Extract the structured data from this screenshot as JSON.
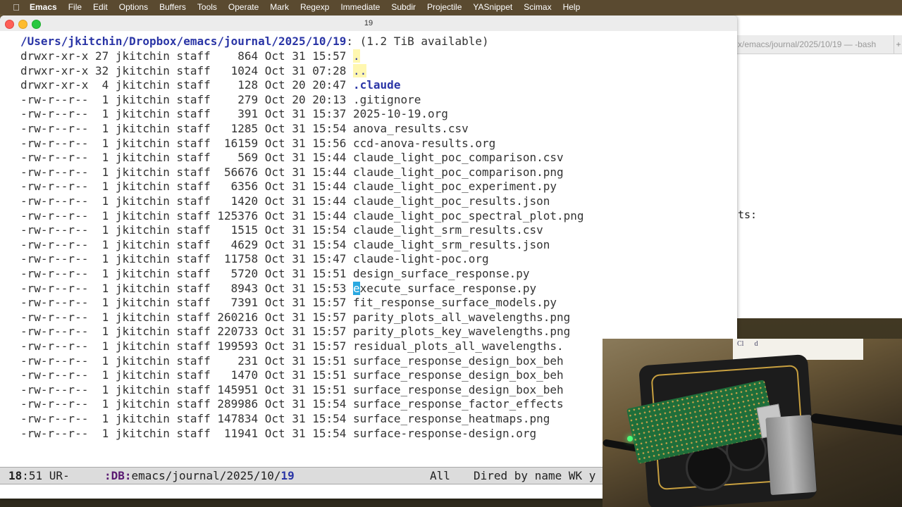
{
  "menubar": {
    "items": [
      "Emacs",
      "File",
      "Edit",
      "Options",
      "Buffers",
      "Tools",
      "Operate",
      "Mark",
      "Regexp",
      "Immediate",
      "Subdir",
      "Projectile",
      "YASnippet",
      "Scimax",
      "Help"
    ]
  },
  "window": {
    "title": "19"
  },
  "terminal": {
    "tab_title": "x/emacs/journal/2025/10/19 — -bash",
    "tab_add": "+",
    "partial_text": "ts:"
  },
  "dired": {
    "header": {
      "path": "/Users/jkitchin/Dropbox/emacs/journal/2025/10/19",
      "rest": ": (1.2 TiB available)"
    },
    "entries": [
      {
        "perm": "drwxr-xr-x",
        "links": "27",
        "owner": "jkitchin",
        "group": "staff",
        "size": "864",
        "date": "Oct 31 15:57",
        "name": ".",
        "kind": "dot"
      },
      {
        "perm": "drwxr-xr-x",
        "links": "32",
        "owner": "jkitchin",
        "group": "staff",
        "size": "1024",
        "date": "Oct 31 07:28",
        "name": "..",
        "kind": "dot"
      },
      {
        "perm": "drwxr-xr-x",
        "links": "4",
        "owner": "jkitchin",
        "group": "staff",
        "size": "128",
        "date": "Oct 20 20:47",
        "name": ".claude",
        "kind": "dir"
      },
      {
        "perm": "-rw-r--r--",
        "links": "1",
        "owner": "jkitchin",
        "group": "staff",
        "size": "279",
        "date": "Oct 20 20:13",
        "name": ".gitignore",
        "kind": "file"
      },
      {
        "perm": "-rw-r--r--",
        "links": "1",
        "owner": "jkitchin",
        "group": "staff",
        "size": "391",
        "date": "Oct 31 15:37",
        "name": "2025-10-19.org",
        "kind": "file"
      },
      {
        "perm": "-rw-r--r--",
        "links": "1",
        "owner": "jkitchin",
        "group": "staff",
        "size": "1285",
        "date": "Oct 31 15:54",
        "name": "anova_results.csv",
        "kind": "file"
      },
      {
        "perm": "-rw-r--r--",
        "links": "1",
        "owner": "jkitchin",
        "group": "staff",
        "size": "16159",
        "date": "Oct 31 15:56",
        "name": "ccd-anova-results.org",
        "kind": "file"
      },
      {
        "perm": "-rw-r--r--",
        "links": "1",
        "owner": "jkitchin",
        "group": "staff",
        "size": "569",
        "date": "Oct 31 15:44",
        "name": "claude_light_poc_comparison.csv",
        "kind": "file"
      },
      {
        "perm": "-rw-r--r--",
        "links": "1",
        "owner": "jkitchin",
        "group": "staff",
        "size": "56676",
        "date": "Oct 31 15:44",
        "name": "claude_light_poc_comparison.png",
        "kind": "file"
      },
      {
        "perm": "-rw-r--r--",
        "links": "1",
        "owner": "jkitchin",
        "group": "staff",
        "size": "6356",
        "date": "Oct 31 15:44",
        "name": "claude_light_poc_experiment.py",
        "kind": "file"
      },
      {
        "perm": "-rw-r--r--",
        "links": "1",
        "owner": "jkitchin",
        "group": "staff",
        "size": "1420",
        "date": "Oct 31 15:44",
        "name": "claude_light_poc_results.json",
        "kind": "file"
      },
      {
        "perm": "-rw-r--r--",
        "links": "1",
        "owner": "jkitchin",
        "group": "staff",
        "size": "125376",
        "date": "Oct 31 15:44",
        "name": "claude_light_poc_spectral_plot.png",
        "kind": "file"
      },
      {
        "perm": "-rw-r--r--",
        "links": "1",
        "owner": "jkitchin",
        "group": "staff",
        "size": "1515",
        "date": "Oct 31 15:54",
        "name": "claude_light_srm_results.csv",
        "kind": "file"
      },
      {
        "perm": "-rw-r--r--",
        "links": "1",
        "owner": "jkitchin",
        "group": "staff",
        "size": "4629",
        "date": "Oct 31 15:54",
        "name": "claude_light_srm_results.json",
        "kind": "file"
      },
      {
        "perm": "-rw-r--r--",
        "links": "1",
        "owner": "jkitchin",
        "group": "staff",
        "size": "11758",
        "date": "Oct 31 15:47",
        "name": "claude-light-poc.org",
        "kind": "file"
      },
      {
        "perm": "-rw-r--r--",
        "links": "1",
        "owner": "jkitchin",
        "group": "staff",
        "size": "5720",
        "date": "Oct 31 15:51",
        "name": "design_surface_response.py",
        "kind": "file"
      },
      {
        "perm": "-rw-r--r--",
        "links": "1",
        "owner": "jkitchin",
        "group": "staff",
        "size": "8943",
        "date": "Oct 31 15:53",
        "name": "execute_surface_response.py",
        "kind": "cursor"
      },
      {
        "perm": "-rw-r--r--",
        "links": "1",
        "owner": "jkitchin",
        "group": "staff",
        "size": "7391",
        "date": "Oct 31 15:57",
        "name": "fit_response_surface_models.py",
        "kind": "file"
      },
      {
        "perm": "-rw-r--r--",
        "links": "1",
        "owner": "jkitchin",
        "group": "staff",
        "size": "260216",
        "date": "Oct 31 15:57",
        "name": "parity_plots_all_wavelengths.png",
        "kind": "file"
      },
      {
        "perm": "-rw-r--r--",
        "links": "1",
        "owner": "jkitchin",
        "group": "staff",
        "size": "220733",
        "date": "Oct 31 15:57",
        "name": "parity_plots_key_wavelengths.png",
        "kind": "file"
      },
      {
        "perm": "-rw-r--r--",
        "links": "1",
        "owner": "jkitchin",
        "group": "staff",
        "size": "199593",
        "date": "Oct 31 15:57",
        "name": "residual_plots_all_wavelengths.",
        "kind": "file"
      },
      {
        "perm": "-rw-r--r--",
        "links": "1",
        "owner": "jkitchin",
        "group": "staff",
        "size": "231",
        "date": "Oct 31 15:51",
        "name": "surface_response_design_box_beh",
        "kind": "file"
      },
      {
        "perm": "-rw-r--r--",
        "links": "1",
        "owner": "jkitchin",
        "group": "staff",
        "size": "1470",
        "date": "Oct 31 15:51",
        "name": "surface_response_design_box_beh",
        "kind": "file"
      },
      {
        "perm": "-rw-r--r--",
        "links": "1",
        "owner": "jkitchin",
        "group": "staff",
        "size": "145951",
        "date": "Oct 31 15:51",
        "name": "surface_response_design_box_beh",
        "kind": "file"
      },
      {
        "perm": "-rw-r--r--",
        "links": "1",
        "owner": "jkitchin",
        "group": "staff",
        "size": "289986",
        "date": "Oct 31 15:54",
        "name": "surface_response_factor_effects",
        "kind": "file"
      },
      {
        "perm": "-rw-r--r--",
        "links": "1",
        "owner": "jkitchin",
        "group": "staff",
        "size": "147834",
        "date": "Oct 31 15:54",
        "name": "surface_response_heatmaps.png",
        "kind": "file"
      },
      {
        "perm": "-rw-r--r--",
        "links": "1",
        "owner": "jkitchin",
        "group": "staff",
        "size": "11941",
        "date": "Oct 31 15:54",
        "name": "surface-response-design.org",
        "kind": "file"
      }
    ]
  },
  "modeline": {
    "line": "18",
    "col_rest": ":51 UR-",
    "db": ":DB:",
    "path": "emacs/journal/2025/10/",
    "buffer_name": "19",
    "position": "All",
    "mode": "Dired by name WK y"
  },
  "webcam": {
    "note": "Cl",
    "note2": "d"
  },
  "colors": {
    "path": "#2a35a6",
    "cursor": "#29a8e0",
    "dot_bg": "#fff7b0"
  }
}
